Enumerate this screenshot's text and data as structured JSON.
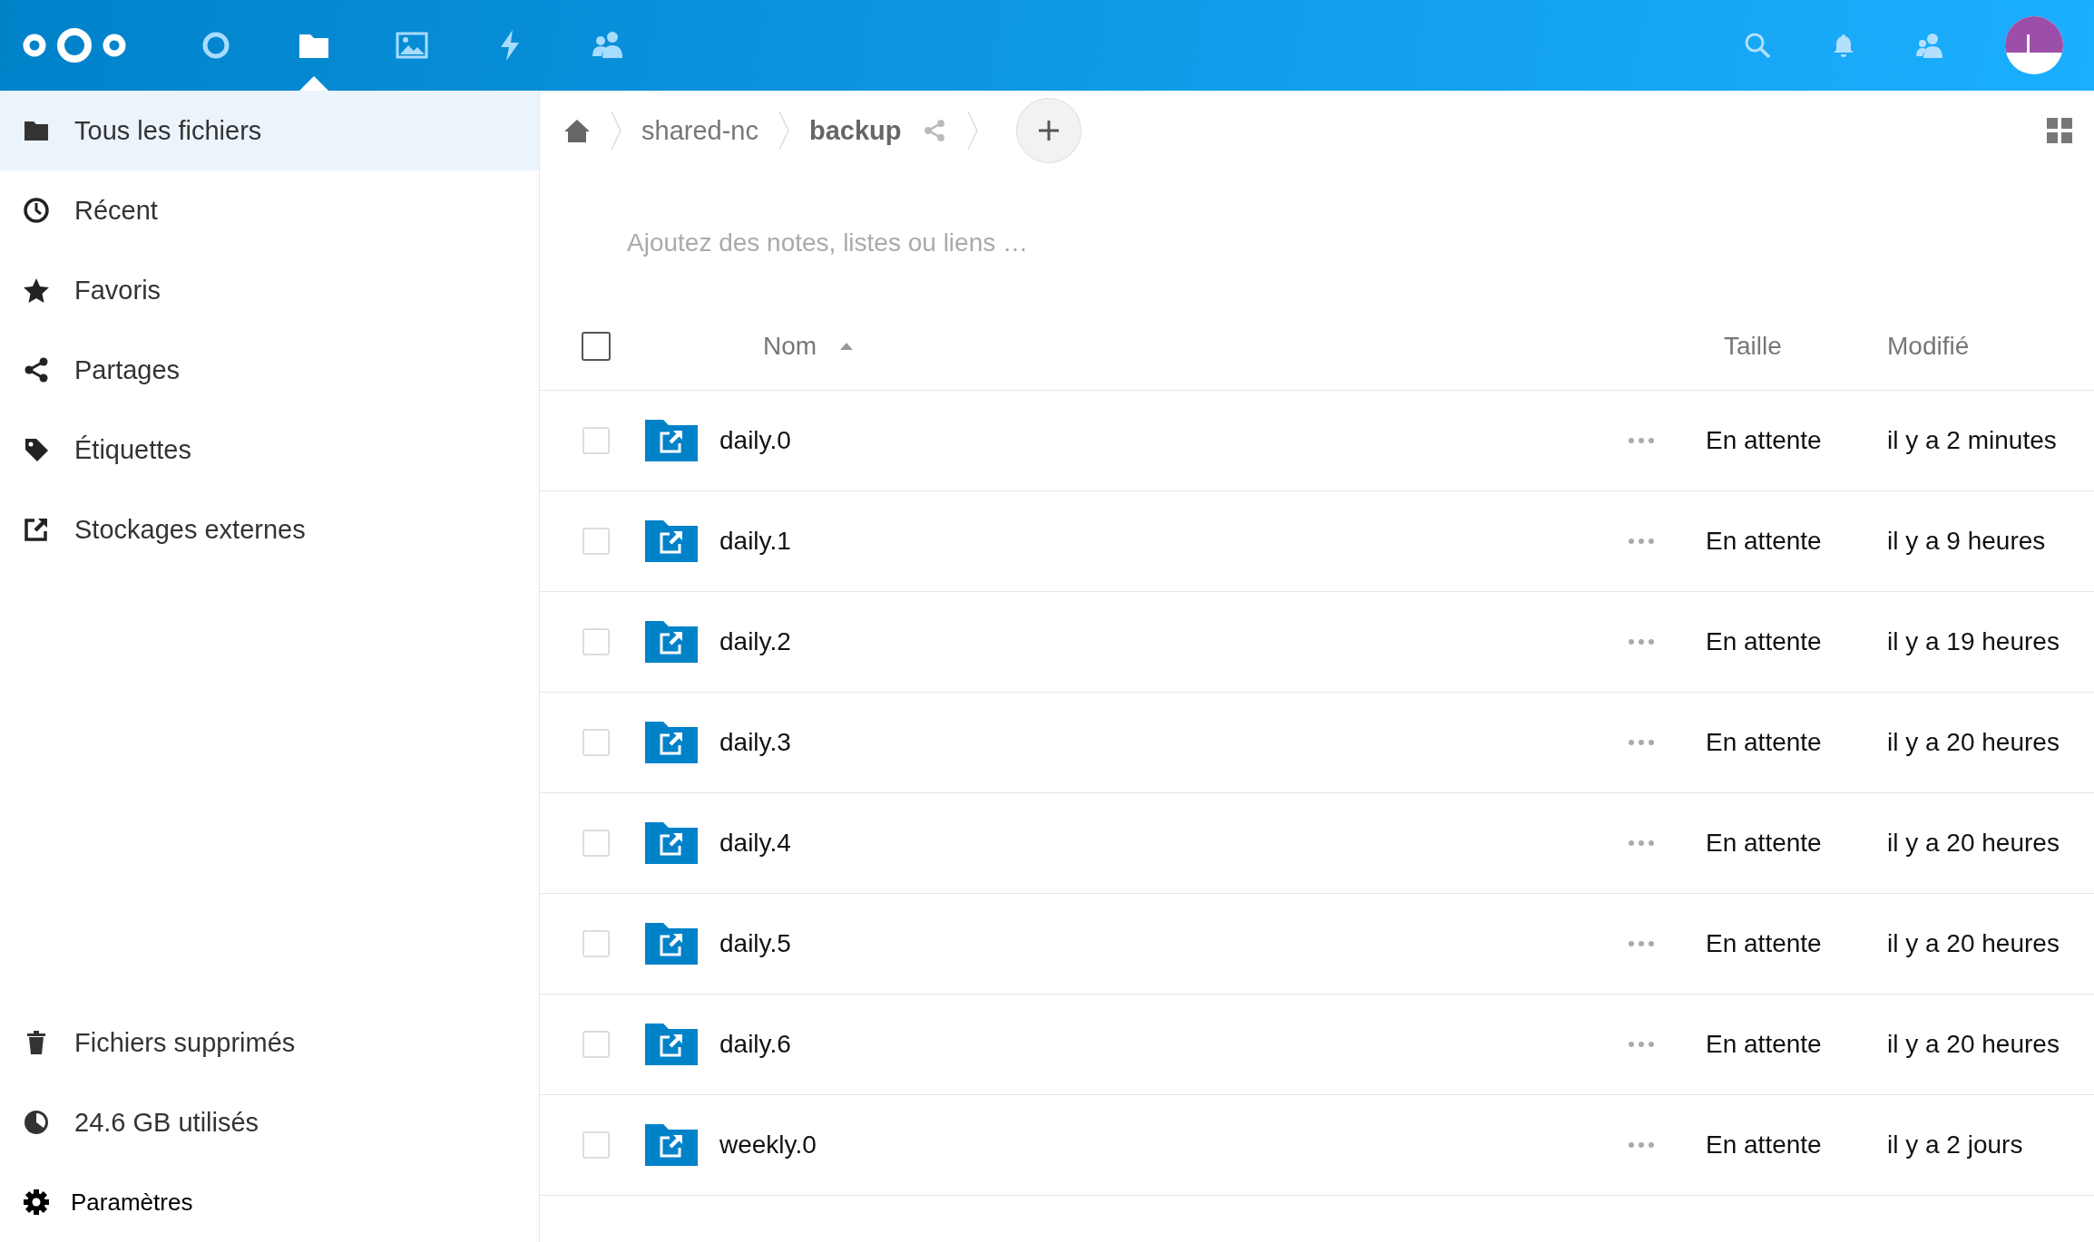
{
  "header": {
    "apps": [
      {
        "selected": false
      },
      {
        "selected": true
      },
      {
        "selected": false
      },
      {
        "selected": false
      },
      {
        "selected": false
      }
    ]
  },
  "sidebar": {
    "items": [
      {
        "label": "Tous les fichiers",
        "selected": true
      },
      {
        "label": "Récent",
        "selected": false
      },
      {
        "label": "Favoris",
        "selected": false
      },
      {
        "label": "Partages",
        "selected": false
      },
      {
        "label": "Étiquettes",
        "selected": false
      },
      {
        "label": "Stockages externes",
        "selected": false
      }
    ],
    "trash": "Fichiers supprimés",
    "quota": "24.6 GB utilisés",
    "settings": "Paramètres"
  },
  "breadcrumb": [
    {
      "label": "shared-nc",
      "current": false
    },
    {
      "label": "backup",
      "current": true
    }
  ],
  "notes": {
    "placeholder": "Ajoutez des notes, listes ou liens …"
  },
  "table": {
    "select_all": {
      "checked": false
    },
    "columns": [
      {
        "label": "Nom",
        "sorted": true
      },
      {
        "label": "Taille",
        "sorted": false
      },
      {
        "label": "Modifié",
        "sorted": false
      }
    ],
    "rows": [
      {
        "name": "daily.0",
        "size": "En attente",
        "modified": "il y a 2 minutes",
        "checked": false
      },
      {
        "name": "daily.1",
        "size": "En attente",
        "modified": "il y a 9 heures",
        "checked": false
      },
      {
        "name": "daily.2",
        "size": "En attente",
        "modified": "il y a 19 heures",
        "checked": false
      },
      {
        "name": "daily.3",
        "size": "En attente",
        "modified": "il y a 20 heures",
        "checked": false
      },
      {
        "name": "daily.4",
        "size": "En attente",
        "modified": "il y a 20 heures",
        "checked": false
      },
      {
        "name": "daily.5",
        "size": "En attente",
        "modified": "il y a 20 heures",
        "checked": false
      },
      {
        "name": "daily.6",
        "size": "En attente",
        "modified": "il y a 20 heures",
        "checked": false
      },
      {
        "name": "weekly.0",
        "size": "En attente",
        "modified": "il y a 2 jours",
        "checked": false
      }
    ]
  }
}
